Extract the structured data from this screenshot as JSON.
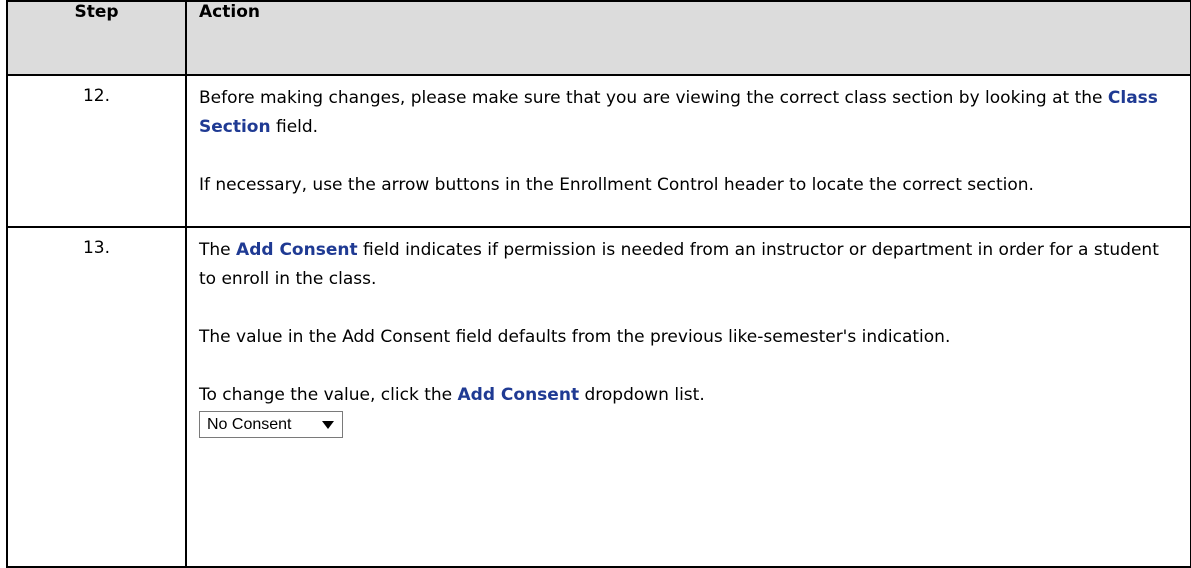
{
  "header": {
    "step": "Step",
    "action": "Action"
  },
  "rows": [
    {
      "step": "12.",
      "p1": {
        "a": "Before making changes, please make sure that you are viewing the correct class section by looking at the ",
        "kw": "Class Section",
        "b": " field."
      },
      "p2": "If necessary, use the arrow buttons in the Enrollment Control header to locate the correct section."
    },
    {
      "step": "13.",
      "p1": {
        "a": "The ",
        "kw": "Add Consent",
        "b": " field indicates if permission is needed from an instructor or department in order for a student to enroll in the class."
      },
      "p2": "The value in the Add Consent field defaults from the previous like-semester's indication.",
      "p3": {
        "a": "To change the value, click the ",
        "kw": "Add Consent",
        "b": " dropdown list."
      },
      "dropdown": {
        "value": "No Consent",
        "icon": "dropdown-arrow-icon"
      }
    }
  ],
  "colors": {
    "header_bg": "#dcdcdc",
    "keyword": "#1f3a93",
    "border": "#000000"
  }
}
